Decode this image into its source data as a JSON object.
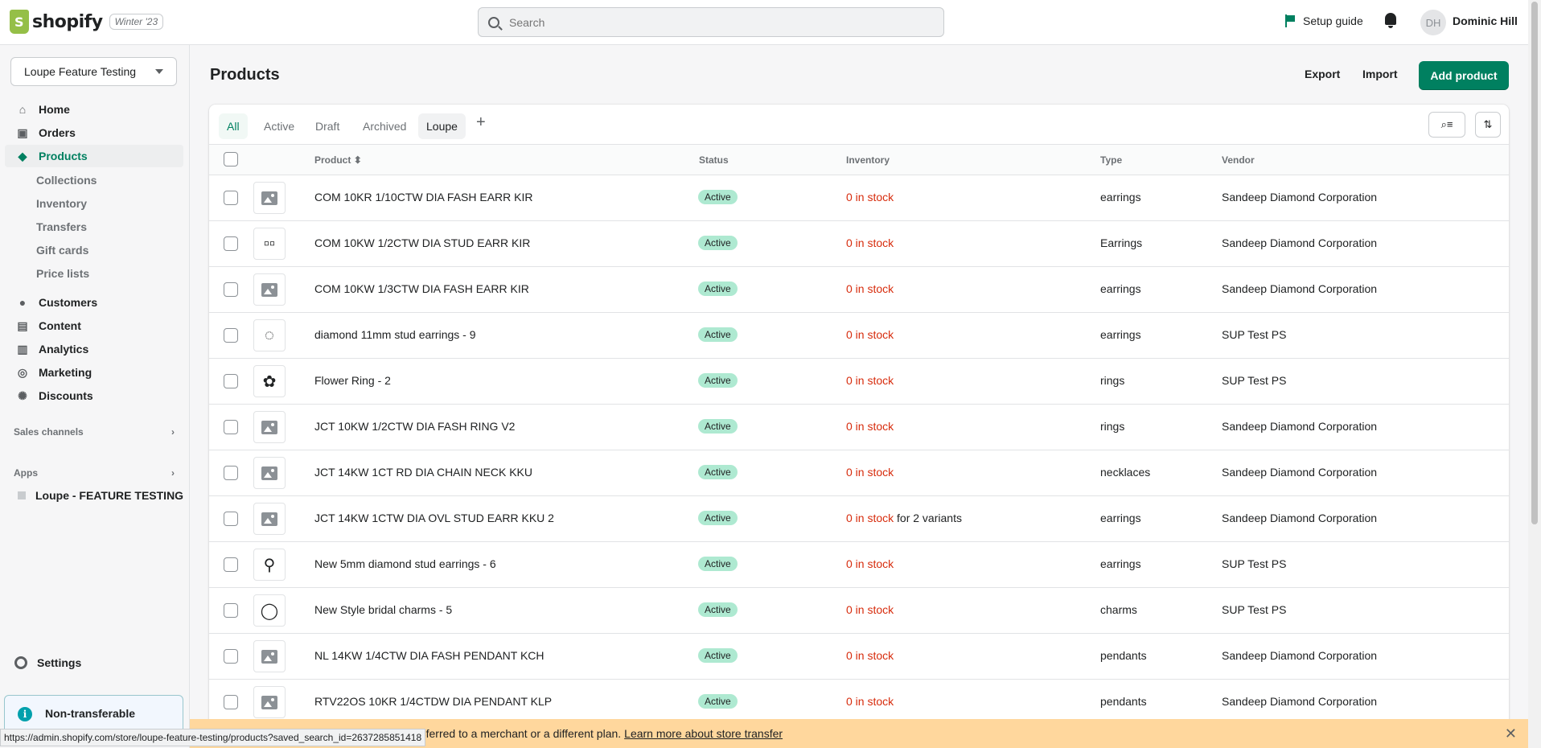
{
  "topbar": {
    "logo_text": "shopify",
    "logo_badge": "Winter '23",
    "search_placeholder": "Search",
    "setup_guide": "Setup guide",
    "avatar_initials": "DH",
    "user_name": "Dominic Hill"
  },
  "sidebar": {
    "store_name": "Loupe Feature Testing",
    "nav": {
      "home": "Home",
      "orders": "Orders",
      "products": "Products",
      "collections": "Collections",
      "inventory": "Inventory",
      "transfers": "Transfers",
      "gift_cards": "Gift cards",
      "price_lists": "Price lists",
      "customers": "Customers",
      "content": "Content",
      "analytics": "Analytics",
      "marketing": "Marketing",
      "discounts": "Discounts"
    },
    "sales_channels": "Sales channels",
    "apps": "Apps",
    "app_item": "Loupe - FEATURE TESTING",
    "settings": "Settings",
    "notice": "Non-transferable"
  },
  "page": {
    "title": "Products",
    "export": "Export",
    "import": "Import",
    "add_product": "Add product"
  },
  "tabs": [
    "All",
    "Active",
    "Draft",
    "Archived",
    "Loupe"
  ],
  "columns": {
    "product": "Product",
    "status": "Status",
    "inventory": "Inventory",
    "type": "Type",
    "vendor": "Vendor"
  },
  "rows": [
    {
      "name": "COM 10KR 1/10CTW DIA FASH EARR KIR",
      "status": "Active",
      "stock": "0 in stock",
      "stock_extra": "",
      "type": "earrings",
      "vendor": "Sandeep Diamond Corporation",
      "thumb": "image-placeholder"
    },
    {
      "name": "COM 10KW 1/2CTW DIA STUD EARR KIR",
      "status": "Active",
      "stock": "0 in stock",
      "stock_extra": "",
      "type": "Earrings",
      "vendor": "Sandeep Diamond Corporation",
      "thumb": "photo"
    },
    {
      "name": "COM 10KW 1/3CTW DIA FASH EARR KIR",
      "status": "Active",
      "stock": "0 in stock",
      "stock_extra": "",
      "type": "earrings",
      "vendor": "Sandeep Diamond Corporation",
      "thumb": "image-placeholder"
    },
    {
      "name": "diamond 11mm stud earrings - 9",
      "status": "Active",
      "stock": "0 in stock",
      "stock_extra": "",
      "type": "earrings",
      "vendor": "SUP Test PS",
      "thumb": "photo"
    },
    {
      "name": "Flower Ring - 2",
      "status": "Active",
      "stock": "0 in stock",
      "stock_extra": "",
      "type": "rings",
      "vendor": "SUP Test PS",
      "thumb": "photo"
    },
    {
      "name": "JCT 10KW 1/2CTW DIA FASH RING V2",
      "status": "Active",
      "stock": "0 in stock",
      "stock_extra": "",
      "type": "rings",
      "vendor": "Sandeep Diamond Corporation",
      "thumb": "image-placeholder"
    },
    {
      "name": "JCT 14KW 1CT RD DIA CHAIN NECK KKU",
      "status": "Active",
      "stock": "0 in stock",
      "stock_extra": "",
      "type": "necklaces",
      "vendor": "Sandeep Diamond Corporation",
      "thumb": "image-placeholder"
    },
    {
      "name": "JCT 14KW 1CTW DIA OVL STUD EARR KKU 2",
      "status": "Active",
      "stock": "0 in stock",
      "stock_extra": " for 2 variants",
      "type": "earrings",
      "vendor": "Sandeep Diamond Corporation",
      "thumb": "image-placeholder"
    },
    {
      "name": "New 5mm diamond stud earrings - 6",
      "status": "Active",
      "stock": "0 in stock",
      "stock_extra": "",
      "type": "earrings",
      "vendor": "SUP Test PS",
      "thumb": "photo"
    },
    {
      "name": "New Style bridal charms - 5",
      "status": "Active",
      "stock": "0 in stock",
      "stock_extra": "",
      "type": "charms",
      "vendor": "SUP Test PS",
      "thumb": "photo"
    },
    {
      "name": "NL 14KW 1/4CTW DIA FASH PENDANT KCH",
      "status": "Active",
      "stock": "0 in stock",
      "stock_extra": "",
      "type": "pendants",
      "vendor": "Sandeep Diamond Corporation",
      "thumb": "image-placeholder"
    },
    {
      "name": "RTV22OS 10KR 1/4CTDW DIA PENDANT KLP",
      "status": "Active",
      "stock": "0 in stock",
      "stock_extra": "",
      "type": "pendants",
      "vendor": "Sandeep Diamond Corporation",
      "thumb": "image-placeholder"
    }
  ],
  "banner": {
    "text": "can't be transferred to a merchant or a different plan.",
    "link": "Learn more about store transfer"
  },
  "status_url": "https://admin.shopify.com/store/loupe-feature-testing/products?saved_search_id=2637285851418",
  "colors": {
    "accent": "#008060",
    "badge": "#aee9d1",
    "stock_critical": "#d72c0d",
    "banner": "#ffd79d"
  }
}
